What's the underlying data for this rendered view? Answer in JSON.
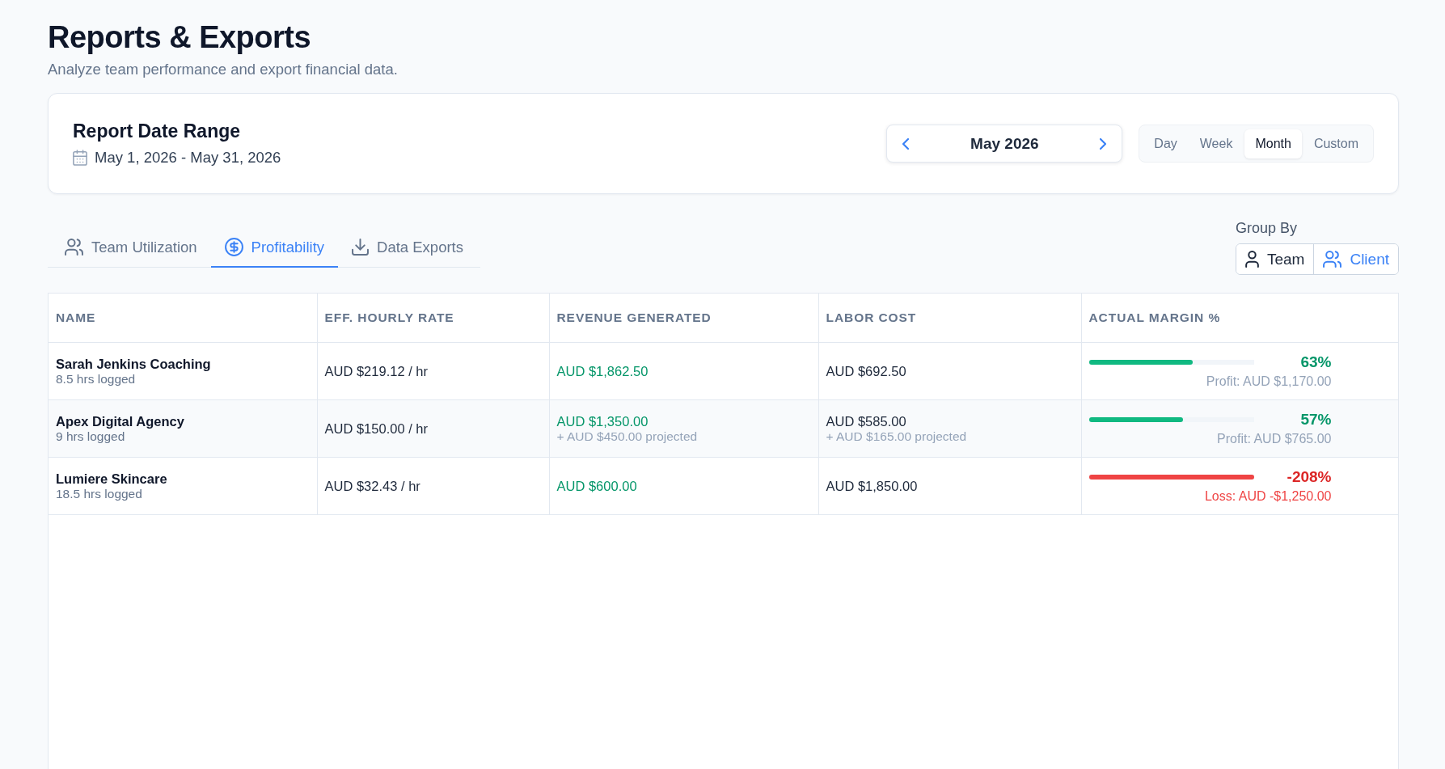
{
  "page": {
    "title": "Reports & Exports",
    "subtitle": "Analyze team performance and export financial data."
  },
  "date_range": {
    "title": "Report Date Range",
    "range": "May 1, 2026 - May 31, 2026",
    "period": "May 2026",
    "period_modes": [
      {
        "label": "Day",
        "selected": false
      },
      {
        "label": "Week",
        "selected": false
      },
      {
        "label": "Month",
        "selected": true
      },
      {
        "label": "Custom",
        "selected": false
      }
    ]
  },
  "tabs": [
    {
      "label": "Team Utilization",
      "selected": false
    },
    {
      "label": "Profitability",
      "selected": true
    },
    {
      "label": "Data Exports",
      "selected": false
    }
  ],
  "group_by": {
    "label": "Group By",
    "options": [
      {
        "label": "Team",
        "selected": false
      },
      {
        "label": "Client",
        "selected": true
      }
    ]
  },
  "table": {
    "columns": [
      "NAME",
      "EFF. HOURLY RATE",
      "REVENUE GENERATED",
      "LABOR COST",
      "ACTUAL MARGIN %"
    ],
    "rows": [
      {
        "name": "Sarah Jenkins Coaching",
        "hours": "8.5 hrs logged",
        "rate": "AUD $219.12 / hr",
        "revenue": "AUD $1,862.50",
        "labor_cost": "AUD $692.50",
        "margin": {
          "kind": "profit",
          "level": 0.63,
          "percent": "63%",
          "note": "Profit: AUD $1,170.00"
        }
      },
      {
        "name": "Apex Digital Agency",
        "hours": "9 hrs logged",
        "rate": "AUD $150.00 / hr",
        "revenue": "AUD $1,350.00",
        "revenue_projected": "+ AUD $450.00 projected",
        "labor_cost": "AUD $585.00",
        "labor_projected": "+ AUD $165.00 projected",
        "margin": {
          "kind": "profit",
          "level": 0.57,
          "percent": "57%",
          "note": "Profit: AUD $765.00"
        }
      },
      {
        "name": "Lumiere Skincare",
        "hours": "18.5 hrs logged",
        "rate": "AUD $32.43 / hr",
        "revenue": "AUD $600.00",
        "labor_cost": "AUD $1,850.00",
        "margin": {
          "kind": "loss",
          "level": 1,
          "percent": "-208%",
          "note": "Loss: AUD -$1,250.00"
        }
      }
    ]
  }
}
